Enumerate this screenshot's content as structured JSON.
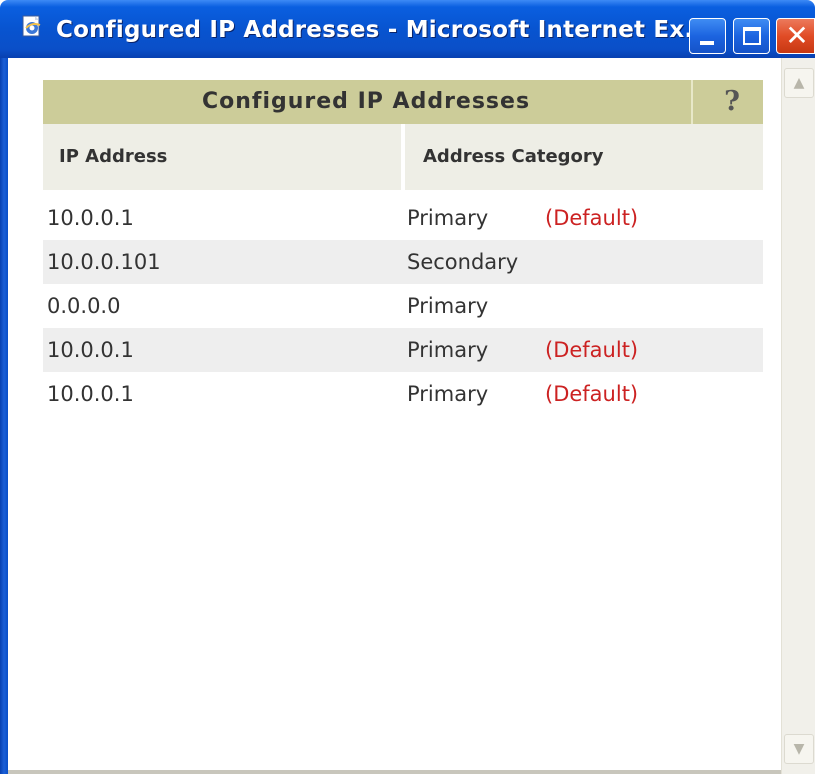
{
  "window": {
    "title": "Configured IP Addresses - Microsoft Internet Ex...",
    "app_icon": "ie-page-icon",
    "controls": [
      "minimize-icon",
      "maximize-icon",
      "close-icon"
    ],
    "close_glyph": "✕"
  },
  "panel": {
    "title": "Configured IP Addresses",
    "help_glyph": "?",
    "header_color": "#cccc99"
  },
  "table": {
    "columns": {
      "ip": "IP Address",
      "category": "Address Category"
    },
    "rows": [
      {
        "ip": "10.0.0.1",
        "category": "Primary",
        "default": "(Default)"
      },
      {
        "ip": "10.0.0.101",
        "category": "Secondary",
        "default": ""
      },
      {
        "ip": "0.0.0.0",
        "category": "Primary",
        "default": ""
      },
      {
        "ip": "10.0.0.1",
        "category": "Primary",
        "default": "(Default)"
      },
      {
        "ip": "10.0.0.1",
        "category": "Primary",
        "default": "(Default)"
      }
    ],
    "default_color": "#cc2222"
  },
  "scrollbar": {
    "up_glyph": "▲",
    "down_glyph": "▼"
  }
}
